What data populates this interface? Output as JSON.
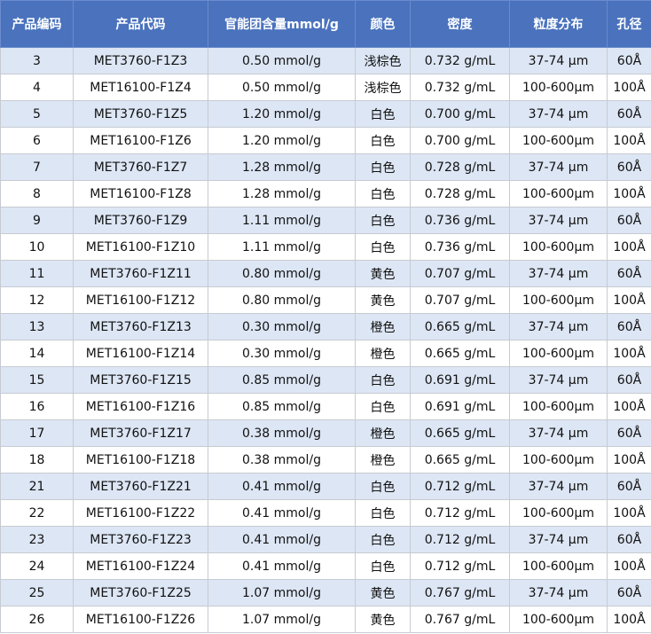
{
  "headers": [
    "产品编码",
    "产品代码",
    "官能团含量mmol/g",
    "颜色",
    "密度",
    "粒度分布",
    "孔径"
  ],
  "rows": [
    [
      "3",
      "MET3760-F1Z3",
      "0.50 mmol/g",
      "浅棕色",
      "0.732 g/mL",
      "37-74 µm",
      "60Å"
    ],
    [
      "4",
      "MET16100-F1Z4",
      "0.50 mmol/g",
      "浅棕色",
      "0.732 g/mL",
      "100-600µm",
      "100Å"
    ],
    [
      "5",
      "MET3760-F1Z5",
      "1.20 mmol/g",
      "白色",
      "0.700 g/mL",
      "37-74 µm",
      "60Å"
    ],
    [
      "6",
      "MET16100-F1Z6",
      "1.20 mmol/g",
      "白色",
      "0.700 g/mL",
      "100-600µm",
      "100Å"
    ],
    [
      "7",
      "MET3760-F1Z7",
      "1.28 mmol/g",
      "白色",
      "0.728 g/mL",
      "37-74 µm",
      "60Å"
    ],
    [
      "8",
      "MET16100-F1Z8",
      "1.28 mmol/g",
      "白色",
      "0.728 g/mL",
      "100-600µm",
      "100Å"
    ],
    [
      "9",
      "MET3760-F1Z9",
      "1.11 mmol/g",
      "白色",
      "0.736 g/mL",
      "37-74 µm",
      "60Å"
    ],
    [
      "10",
      "MET16100-F1Z10",
      "1.11 mmol/g",
      "白色",
      "0.736 g/mL",
      "100-600µm",
      "100Å"
    ],
    [
      "11",
      "MET3760-F1Z11",
      "0.80 mmol/g",
      "黄色",
      "0.707 g/mL",
      "37-74 µm",
      "60Å"
    ],
    [
      "12",
      "MET16100-F1Z12",
      "0.80 mmol/g",
      "黄色",
      "0.707 g/mL",
      "100-600µm",
      "100Å"
    ],
    [
      "13",
      "MET3760-F1Z13",
      "0.30 mmol/g",
      "橙色",
      "0.665 g/mL",
      "37-74 µm",
      "60Å"
    ],
    [
      "14",
      "MET16100-F1Z14",
      "0.30 mmol/g",
      "橙色",
      "0.665 g/mL",
      "100-600µm",
      "100Å"
    ],
    [
      "15",
      "MET3760-F1Z15",
      "0.85 mmol/g",
      "白色",
      "0.691 g/mL",
      "37-74 µm",
      "60Å"
    ],
    [
      "16",
      "MET16100-F1Z16",
      "0.85 mmol/g",
      "白色",
      "0.691 g/mL",
      "100-600µm",
      "100Å"
    ],
    [
      "17",
      "MET3760-F1Z17",
      "0.38 mmol/g",
      "橙色",
      "0.665 g/mL",
      "37-74 µm",
      "60Å"
    ],
    [
      "18",
      "MET16100-F1Z18",
      "0.38 mmol/g",
      "橙色",
      "0.665 g/mL",
      "100-600µm",
      "100Å"
    ],
    [
      "21",
      "MET3760-F1Z21",
      "0.41 mmol/g",
      "白色",
      "0.712 g/mL",
      "37-74 µm",
      "60Å"
    ],
    [
      "22",
      "MET16100-F1Z22",
      "0.41 mmol/g",
      "白色",
      "0.712 g/mL",
      "100-600µm",
      "100Å"
    ],
    [
      "23",
      "MET3760-F1Z23",
      "0.41 mmol/g",
      "白色",
      "0.712 g/mL",
      "37-74 µm",
      "60Å"
    ],
    [
      "24",
      "MET16100-F1Z24",
      "0.41 mmol/g",
      "白色",
      "0.712 g/mL",
      "100-600µm",
      "100Å"
    ],
    [
      "25",
      "MET3760-F1Z25",
      "1.07 mmol/g",
      "黄色",
      "0.767 g/mL",
      "37-74 µm",
      "60Å"
    ],
    [
      "26",
      "MET16100-F1Z26",
      "1.07 mmol/g",
      "黄色",
      "0.767 g/mL",
      "100-600µm",
      "100Å"
    ]
  ]
}
